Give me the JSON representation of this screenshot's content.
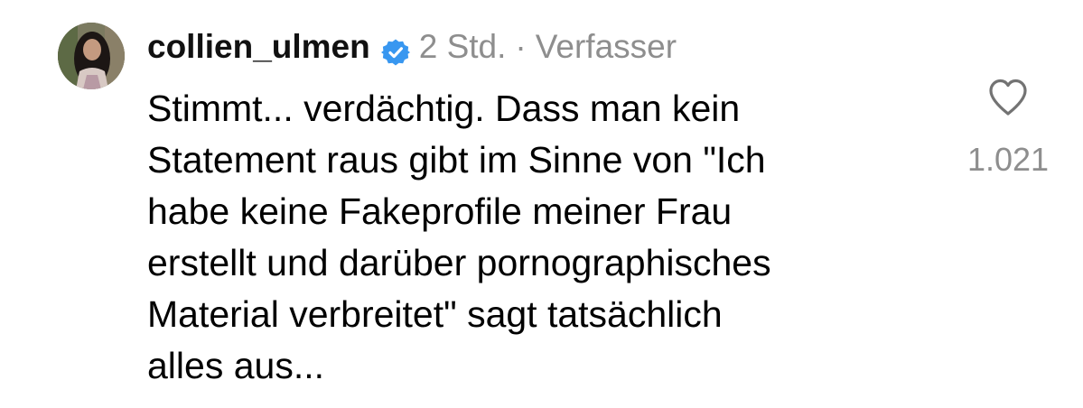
{
  "comment": {
    "username": "collien_ulmen",
    "verified_icon": "verified-badge-icon",
    "time": "2 Std.",
    "separator": "·",
    "author_tag": "Verfasser",
    "text_lines": [
      "Stimmt... verdächtig. Dass man kein",
      "Statement raus gibt im Sinne von \"Ich",
      "habe keine Fakeprofile meiner Frau",
      "erstellt und darüber pornographisches",
      "Material verbreitet\" sagt tatsächlich",
      "alles aus..."
    ],
    "like_icon": "heart-icon",
    "like_count": "1.021"
  },
  "colors": {
    "verified_blue": "#3897f0",
    "meta_gray": "#8e8e8e",
    "text": "#000000"
  }
}
